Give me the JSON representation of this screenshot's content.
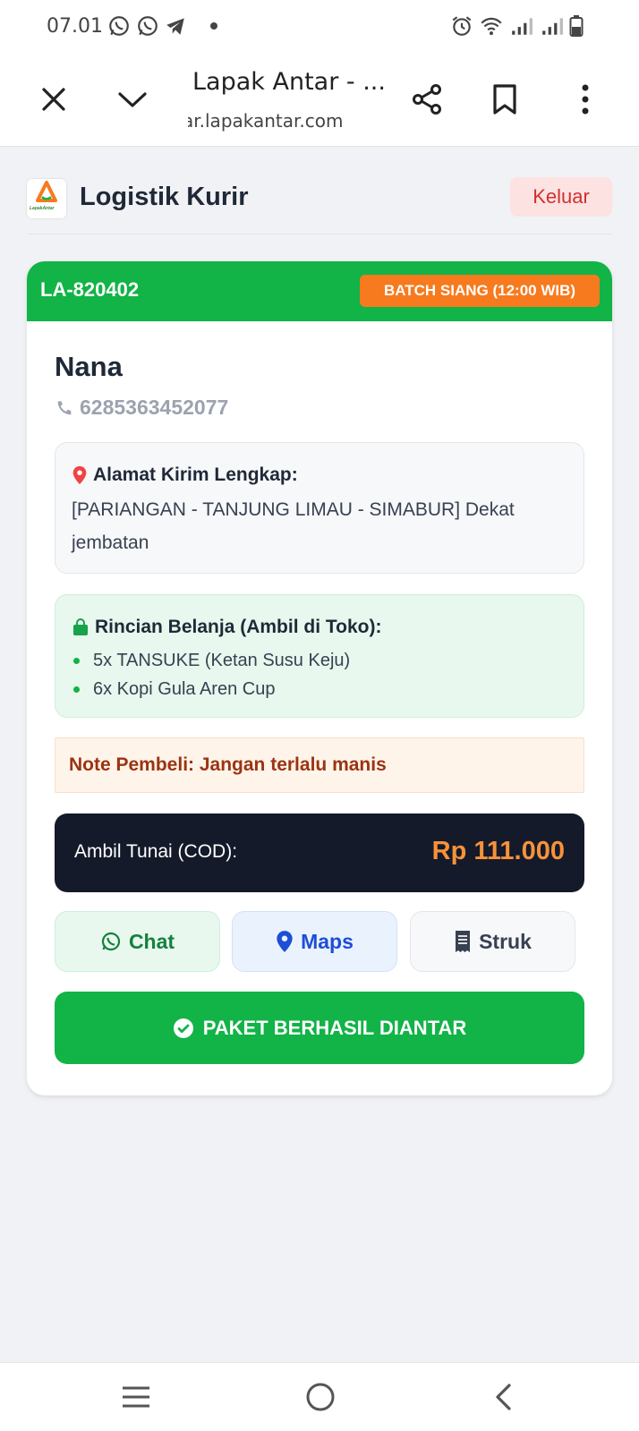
{
  "status_bar": {
    "time": "07.01",
    "icons": [
      "whatsapp-icon",
      "whatsapp-icon",
      "telegram-icon",
      "dot-icon",
      "alarm-icon",
      "wifi-icon",
      "signal-icon",
      "signal-icon",
      "battery-icon"
    ]
  },
  "browser": {
    "title": "Lapak Antar - ...",
    "url": "ar.lapakantar.com",
    "buttons": [
      "close-icon",
      "chevron-down-icon",
      "share-icon",
      "bookmark-icon",
      "more-vert-icon"
    ]
  },
  "header": {
    "logo_caption": "LapakAntar",
    "title": "Logistik Kurir",
    "logout_label": "Keluar"
  },
  "order": {
    "id": "LA-820402",
    "batch": "BATCH SIANG (12:00 WIB)",
    "customer_name": "Nana",
    "phone": "6285363452077",
    "address_title": "Alamat Kirim Lengkap:",
    "address": "[PARIANGAN - TANJUNG LIMAU - SIMABUR] Dekat jembatan",
    "shopping_title": "Rincian Belanja (Ambil di Toko):",
    "items": [
      "5x TANSUKE (Ketan Susu Keju)",
      "6x Kopi Gula Aren Cup"
    ],
    "note": "Note Pembeli: Jangan terlalu manis",
    "cod_label": "Ambil Tunai (COD):",
    "cod_amount": "Rp 111.000"
  },
  "actions": {
    "chat": "Chat",
    "maps": "Maps",
    "struk": "Struk",
    "delivered": "PAKET BERHASIL DIANTAR"
  },
  "colors": {
    "green": "#12b347",
    "orange": "#f77a1e",
    "dark": "#141a2a",
    "red": "#d32f2f"
  }
}
